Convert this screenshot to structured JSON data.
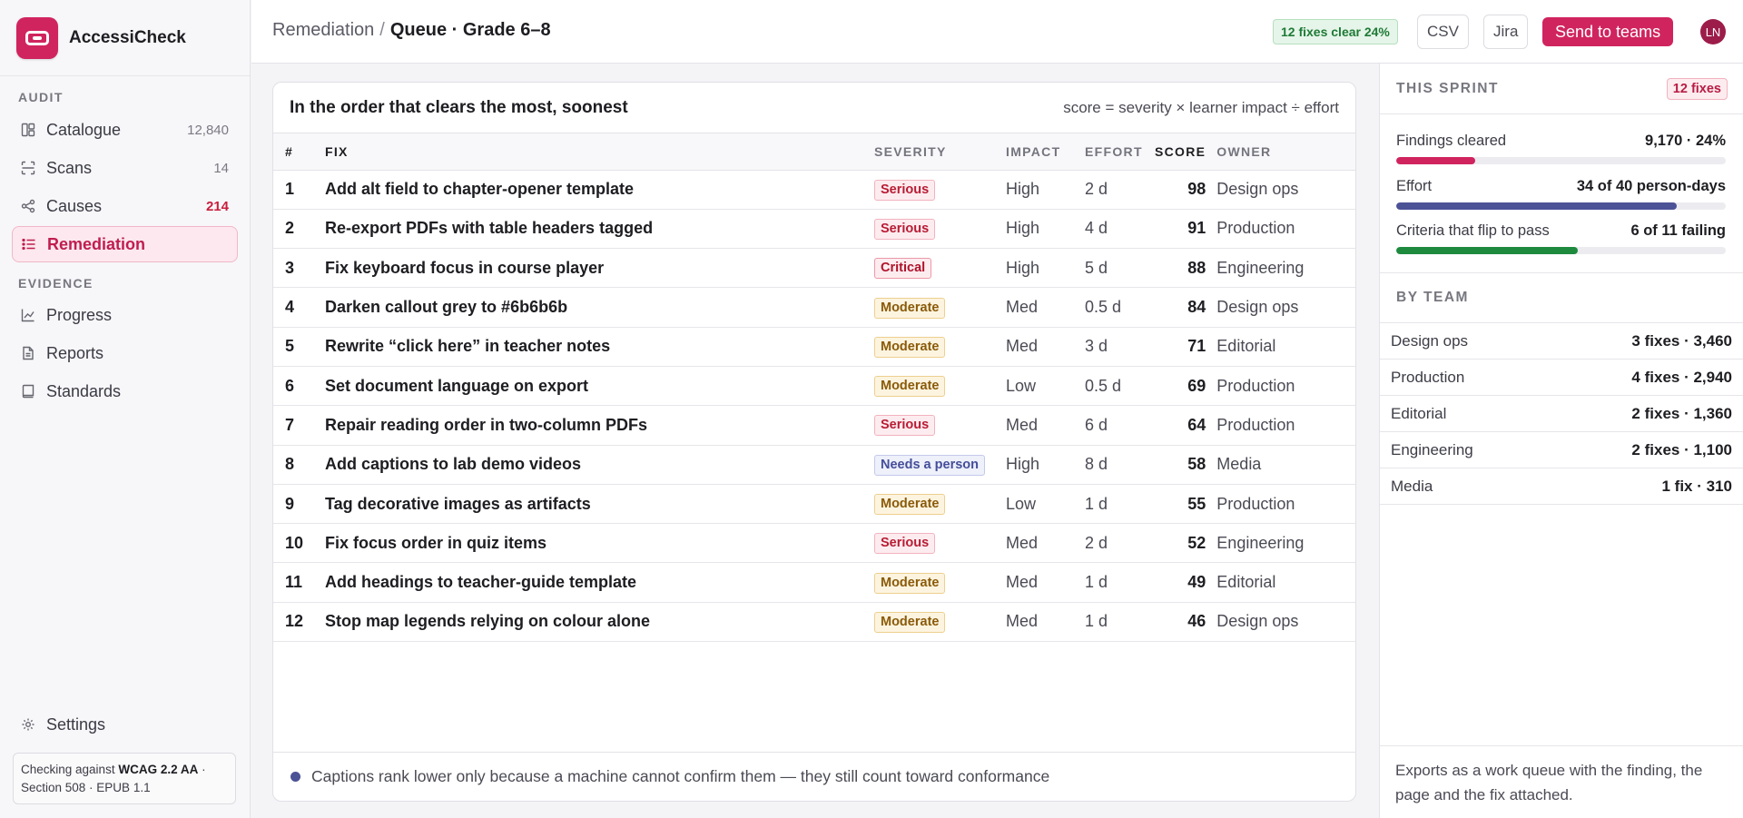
{
  "app": {
    "name": "AccessiCheck"
  },
  "sidebar": {
    "sections": {
      "audit": "AUDIT",
      "evidence": "EVIDENCE"
    },
    "audit_items": [
      {
        "label": "Catalogue",
        "count": "12,840",
        "icon": "catalogue-icon"
      },
      {
        "label": "Scans",
        "count": "14",
        "icon": "scan-icon"
      },
      {
        "label": "Causes",
        "count": "214",
        "icon": "causes-icon"
      },
      {
        "label": "Remediation",
        "count": "",
        "icon": "list-icon"
      }
    ],
    "evidence_items": [
      {
        "label": "Progress",
        "icon": "chart-icon"
      },
      {
        "label": "Reports",
        "icon": "report-icon"
      },
      {
        "label": "Standards",
        "icon": "book-icon"
      }
    ],
    "settings_label": "Settings",
    "checking": {
      "prefix": "Checking against",
      "standard": "WCAG 2.2 AA",
      "rest": "· Section 508 · EPUB 1.1"
    }
  },
  "header": {
    "crumb_parent": "Remediation",
    "crumb_sep": "/",
    "crumb_current": "Queue · Grade 6–8",
    "clear_badge": "12 fixes clear 24%",
    "csv_label": "CSV",
    "jira_label": "Jira",
    "send_label": "Send to teams",
    "avatar_initials": "LN"
  },
  "queue": {
    "title": "In the order that clears the most, soonest",
    "formula": "score = severity × learner impact ÷ effort",
    "columns": {
      "num": "#",
      "fix": "FIX",
      "severity": "SEVERITY",
      "impact": "IMPACT",
      "effort": "EFFORT",
      "score": "SCORE",
      "owner": "OWNER"
    },
    "rows": [
      {
        "num": "1",
        "fix": "Add alt field to chapter-opener template",
        "severity": "Serious",
        "sev_class": "serious",
        "impact": "High",
        "effort": "2 d",
        "score": "98",
        "owner": "Design ops"
      },
      {
        "num": "2",
        "fix": "Re-export PDFs with table headers tagged",
        "severity": "Serious",
        "sev_class": "serious",
        "impact": "High",
        "effort": "4 d",
        "score": "91",
        "owner": "Production"
      },
      {
        "num": "3",
        "fix": "Fix keyboard focus in course player",
        "severity": "Critical",
        "sev_class": "critical",
        "impact": "High",
        "effort": "5 d",
        "score": "88",
        "owner": "Engineering"
      },
      {
        "num": "4",
        "fix": "Darken callout grey to #6b6b6b",
        "severity": "Moderate",
        "sev_class": "moderate",
        "impact": "Med",
        "effort": "0.5 d",
        "score": "84",
        "owner": "Design ops"
      },
      {
        "num": "5",
        "fix": "Rewrite “click here” in teacher notes",
        "severity": "Moderate",
        "sev_class": "moderate",
        "impact": "Med",
        "effort": "3 d",
        "score": "71",
        "owner": "Editorial"
      },
      {
        "num": "6",
        "fix": "Set document language on export",
        "severity": "Moderate",
        "sev_class": "moderate",
        "impact": "Low",
        "effort": "0.5 d",
        "score": "69",
        "owner": "Production"
      },
      {
        "num": "7",
        "fix": "Repair reading order in two-column PDFs",
        "severity": "Serious",
        "sev_class": "serious",
        "impact": "Med",
        "effort": "6 d",
        "score": "64",
        "owner": "Production"
      },
      {
        "num": "8",
        "fix": "Add captions to lab demo videos",
        "severity": "Needs a person",
        "sev_class": "person",
        "impact": "High",
        "effort": "8 d",
        "score": "58",
        "owner": "Media"
      },
      {
        "num": "9",
        "fix": "Tag decorative images as artifacts",
        "severity": "Moderate",
        "sev_class": "moderate",
        "impact": "Low",
        "effort": "1 d",
        "score": "55",
        "owner": "Production"
      },
      {
        "num": "10",
        "fix": "Fix focus order in quiz items",
        "severity": "Serious",
        "sev_class": "serious",
        "impact": "Med",
        "effort": "2 d",
        "score": "52",
        "owner": "Engineering"
      },
      {
        "num": "11",
        "fix": "Add headings to teacher-guide template",
        "severity": "Moderate",
        "sev_class": "moderate",
        "impact": "Med",
        "effort": "1 d",
        "score": "49",
        "owner": "Editorial"
      },
      {
        "num": "12",
        "fix": "Stop map legends relying on colour alone",
        "severity": "Moderate",
        "sev_class": "moderate",
        "impact": "Med",
        "effort": "1 d",
        "score": "46",
        "owner": "Design ops"
      }
    ],
    "footnote": "Captions rank lower only because a machine cannot confirm them — they still count toward conformance"
  },
  "sprint": {
    "label": "THIS SPRINT",
    "badge": "12 fixes",
    "metrics": [
      {
        "label": "Findings cleared",
        "value": "9,170 · 24%",
        "fraction": 0.24,
        "color": "#d0245f"
      },
      {
        "label": "Effort",
        "value": "34 of 40 person-days",
        "fraction": 0.85,
        "color": "#4b5296"
      },
      {
        "label": "Criteria that flip to pass",
        "value": "6 of 11 failing",
        "fraction": 0.55,
        "color": "#1e8a3e"
      }
    ],
    "by_team_label": "BY TEAM",
    "teams": [
      {
        "name": "Design ops",
        "value": "3 fixes · 3,460"
      },
      {
        "name": "Production",
        "value": "4 fixes · 2,940"
      },
      {
        "name": "Editorial",
        "value": "2 fixes · 1,360"
      },
      {
        "name": "Engineering",
        "value": "2 fixes · 1,100"
      },
      {
        "name": "Media",
        "value": "1 fix · 310"
      }
    ],
    "footer": "Exports as a work queue with the finding, the page and the fix attached."
  }
}
